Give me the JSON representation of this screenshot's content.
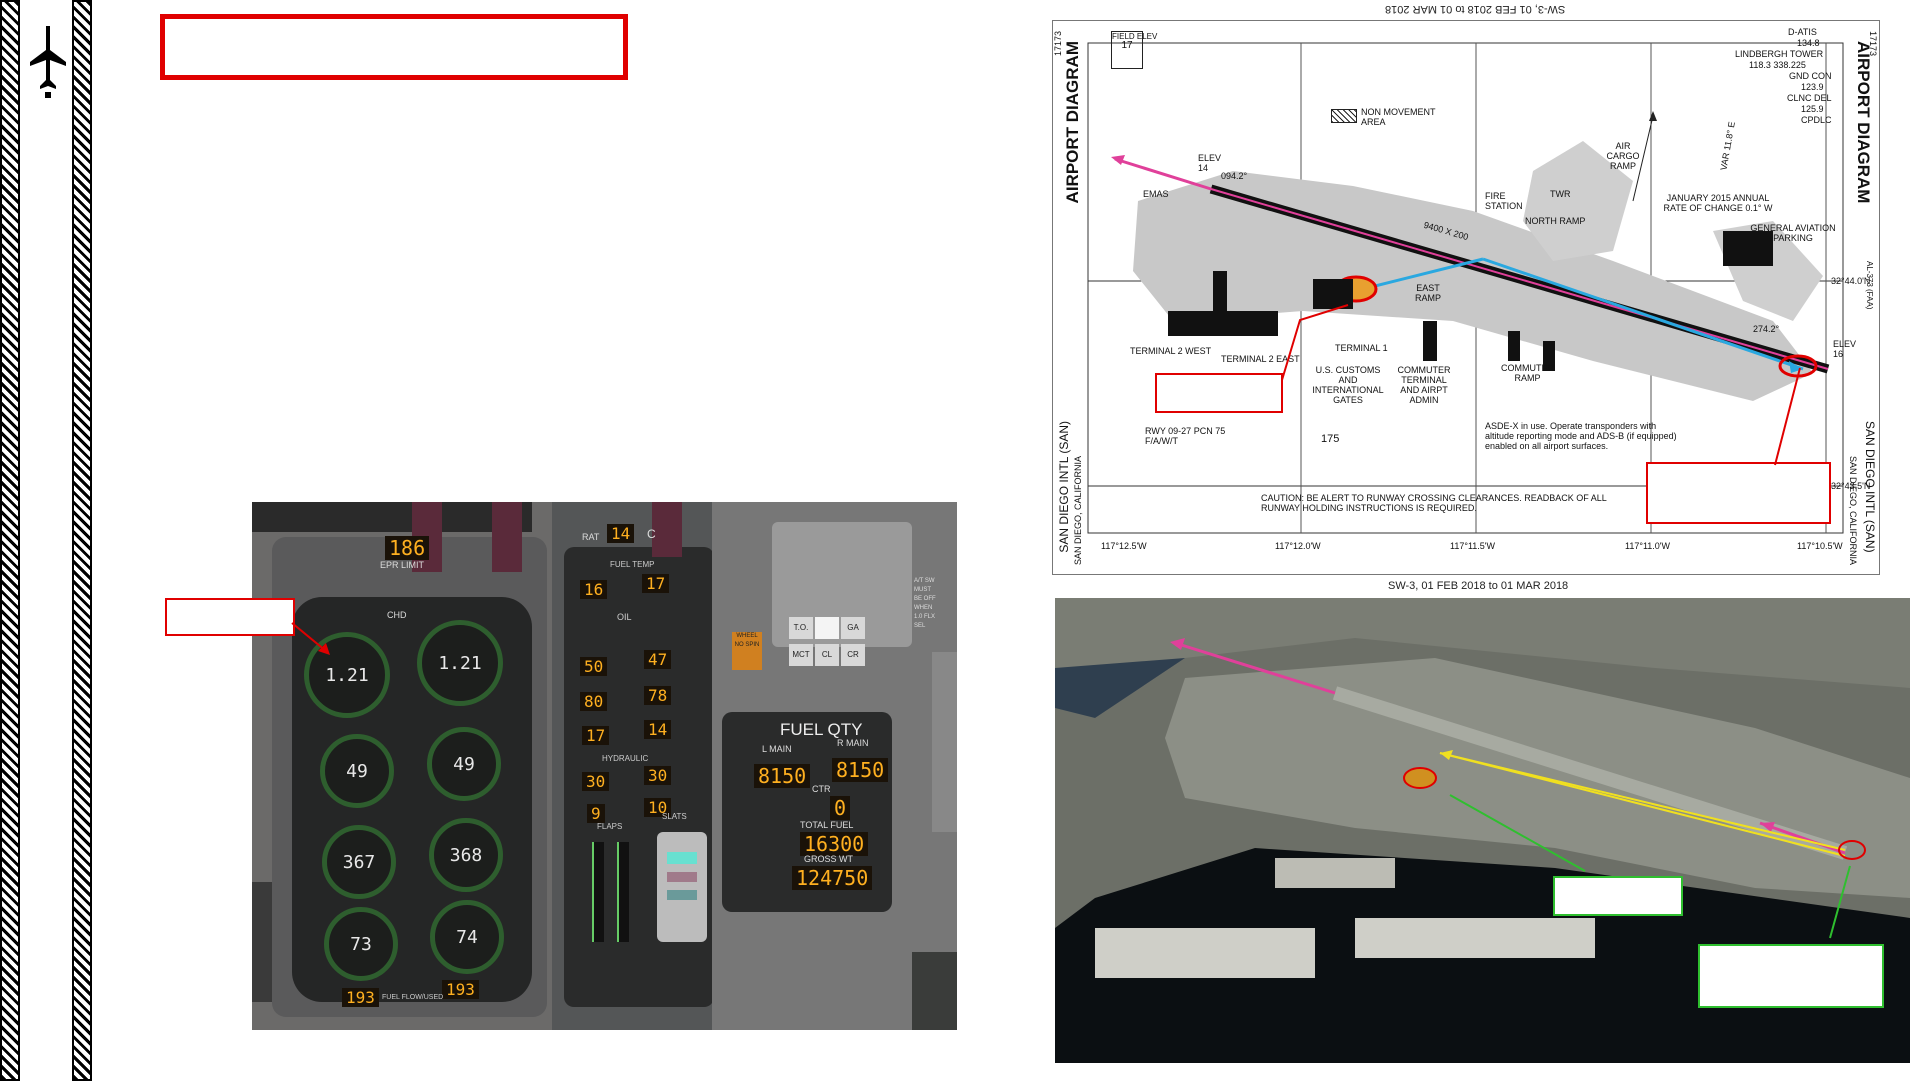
{
  "sidebar": {
    "icon": "airplane-icon"
  },
  "cockpit": {
    "epr_limit": "186",
    "epr_limit_label": "EPR LIMIT",
    "chd_label": "CHD",
    "epr_left": "1.21",
    "epr_right": "1.21",
    "n1_left": "49",
    "n1_right": "49",
    "egt_left": "367",
    "egt_right": "368",
    "n2_left": "73",
    "n2_right": "74",
    "fuel_flow_left": "193",
    "fuel_flow_right": "193",
    "fuel_flow_label": "FUEL FLOW/USED",
    "rat": "14",
    "rat_label": "RAT",
    "rat_unit": "C",
    "fuel_temp_label": "FUEL TEMP",
    "fuel_temp_left": "16",
    "fuel_temp_right": "17",
    "oil_label": "OIL",
    "oil_press_left": "50",
    "oil_press_right": "47",
    "oil_temp_left": "80",
    "oil_temp_right": "78",
    "oil_qty_left": "17",
    "oil_qty_right": "14",
    "hydraulic_label": "HYDRAULIC",
    "hyd_press_left": "30",
    "hyd_press_right": "30",
    "hyd_qty_left": "9",
    "hyd_qty_right": "10",
    "flaps_label": "FLAPS",
    "slats_label": "SLATS",
    "fuel_qty_title": "FUEL QTY",
    "l_main_label": "L MAIN",
    "r_main_label": "R MAIN",
    "l_main": "8150",
    "r_main": "8150",
    "ctr_label": "CTR",
    "ctr": "0",
    "total_fuel_label": "TOTAL FUEL",
    "total_fuel": "16300",
    "gross_wt_label": "GROSS WT",
    "gross_wt": "124750",
    "to_label": "T.O.",
    "mct_label": "MCT",
    "cl_label": "CL",
    "ga_label": "GA",
    "cr_label": "CR",
    "wheel_label": "WHEEL NO SPIN",
    "side_text": "A/T SW MUST BE OFF WHEN 1.0 FLX SEL"
  },
  "diagram": {
    "top_caption": "SW-3, 01 FEB 2018 to 01 MAR 2018",
    "bottom_caption": "SW-3, 01 FEB 2018 to 01 MAR 2018",
    "title_left": "AIRPORT DIAGRAM",
    "title_right": "AIRPORT DIAGRAM",
    "chart_number_left": "17173",
    "chart_number_right": "17173",
    "field_elev_label": "FIELD ELEV",
    "field_elev": "17",
    "freq_datis": "D-ATIS",
    "freq_datis_val": "134.8",
    "freq_tower": "LINDBERGH TOWER",
    "freq_tower_val": "118.3 338.225",
    "freq_gnd": "GND CON",
    "freq_gnd_val": "123.9",
    "freq_clnc": "CLNC DEL",
    "freq_clnc_val": "125.9",
    "freq_cpdlc": "CPDLC",
    "non_movement": "NON MOVEMENT AREA",
    "elev_14": "ELEV 14",
    "elev_16": "ELEV 16",
    "hdg_094": "094.2°",
    "hdg_274": "274.2°",
    "runway_dim": "9400 X 200",
    "emas": "EMAS",
    "fire_station": "FIRE STATION",
    "twr": "TWR",
    "north_ramp": "NORTH RAMP",
    "air_cargo": "AIR CARGO RAMP",
    "jan_2015": "JANUARY 2015 ANNUAL RATE OF CHANGE 0.1° W",
    "var": "VAR 11.8° E",
    "ga_parking": "GENERAL AVIATION PARKING",
    "east_ramp": "EAST RAMP",
    "terminal1": "TERMINAL 1",
    "terminal2w": "TERMINAL 2 WEST",
    "terminal2e": "TERMINAL 2 EAST",
    "customs": "U.S. CUSTOMS AND INTERNATIONAL GATES",
    "commuter_term": "COMMUTER TERMINAL AND AIRPT ADMIN",
    "commuter_ramp": "COMMUTER RAMP",
    "rwy_info": "RWY 09-27 PCN 75 F/A/W/T",
    "alt_175": "175",
    "asde": "ASDE-X in use. Operate transponders with altitude reporting mode and ADS-B (if equipped) enabled on all airport surfaces.",
    "caution": "CAUTION: BE ALERT TO RUNWAY CROSSING CLEARANCES. READBACK OF ALL RUNWAY HOLDING INSTRUCTIONS IS REQUIRED.",
    "lat_44": "32°44.0'N",
    "lat_43": "32°43.5'N",
    "al_note": "AL-373 (FAA)",
    "lon_1": "117°12.5'W",
    "lon_2": "117°12.0'W",
    "lon_3": "117°11.5'W",
    "lon_4": "117°11.0'W",
    "lon_5": "117°10.5'W",
    "side_left": "SAN DIEGO INTL (SAN)",
    "side_left2": "SAN DIEGO, CALIFORNIA",
    "side_right": "SAN DIEGO INTL (SAN)",
    "side_right2": "SAN DIEGO, CALIFORNIA"
  },
  "colors": {
    "red": "#e00000",
    "green": "#2fbf2f",
    "pink": "#e0409a",
    "blue": "#2aa8e0",
    "yellow": "#f0e020"
  }
}
